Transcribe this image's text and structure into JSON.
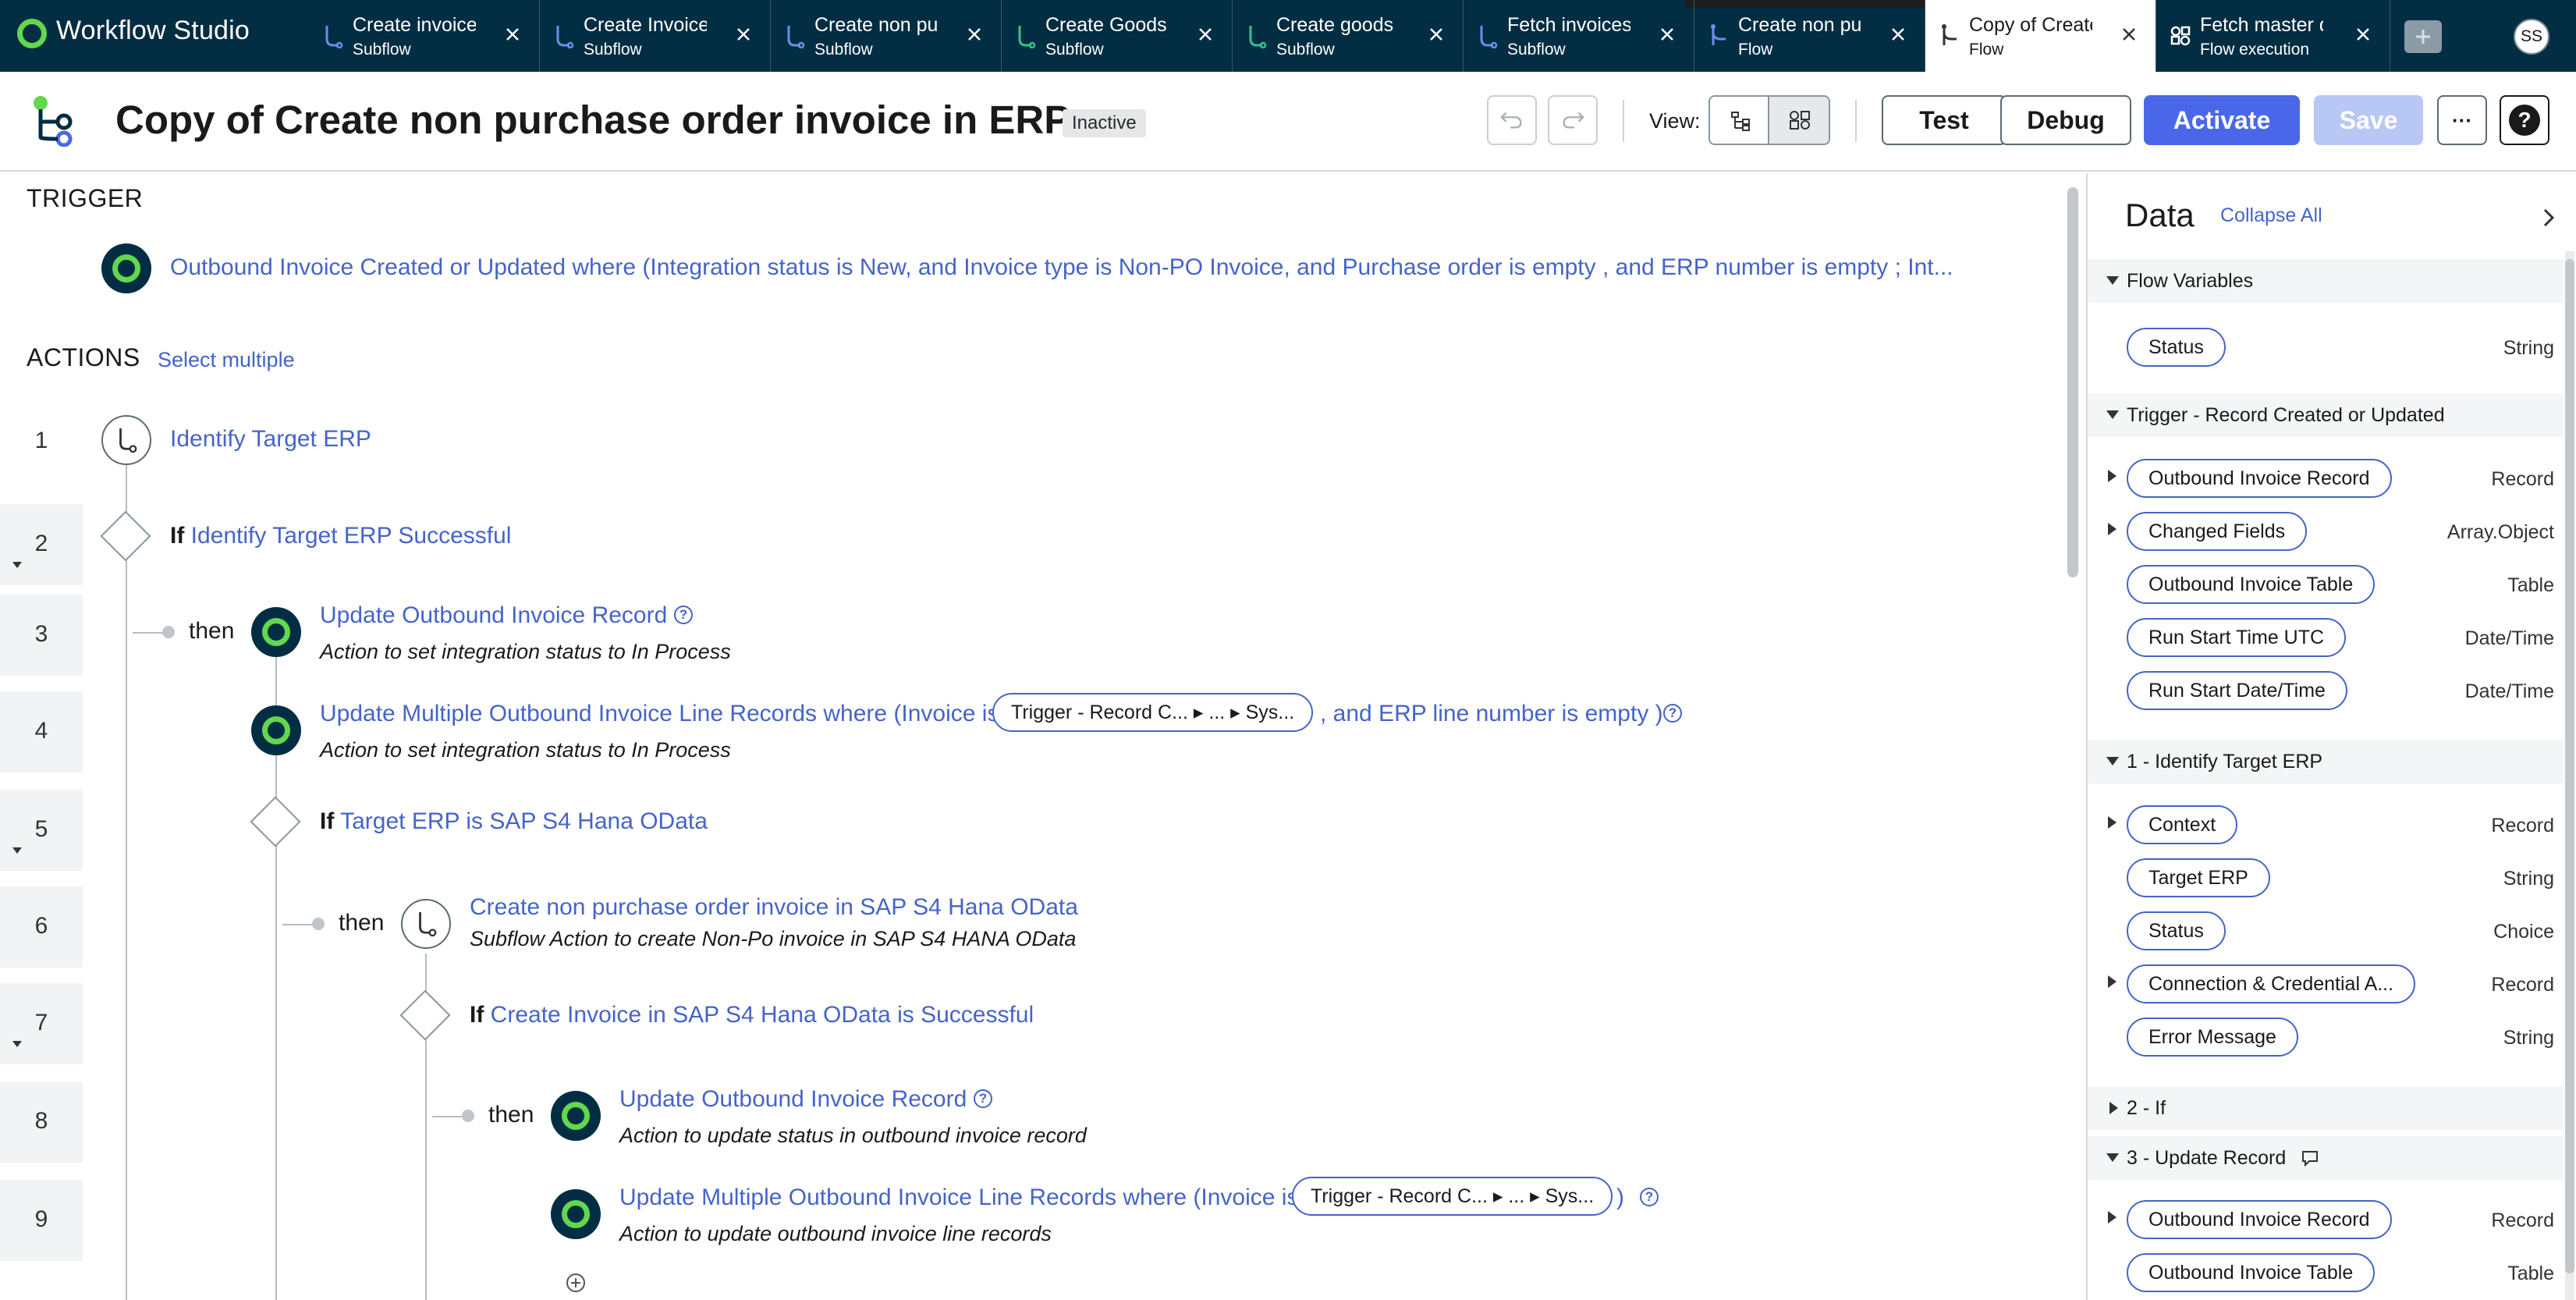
{
  "app": {
    "title": "Workflow Studio",
    "user_initials": "SS"
  },
  "tabs": [
    {
      "name": "Create invoice",
      "type": "Subflow"
    },
    {
      "name": "Create Invoice",
      "type": "Subflow"
    },
    {
      "name": "Create non pu",
      "type": "Subflow"
    },
    {
      "name": "Create Goods",
      "type": "Subflow"
    },
    {
      "name": "Create goods r",
      "type": "Subflow"
    },
    {
      "name": "Fetch invoices",
      "type": "Subflow"
    },
    {
      "name": "Create non pu",
      "type": "Flow"
    },
    {
      "name": "Copy of Create",
      "type": "Flow"
    },
    {
      "name": "Fetch master d",
      "type": "Flow execution"
    }
  ],
  "header": {
    "title": "Copy of Create non purchase order invoice in ERP",
    "status": "Inactive",
    "view_label": "View:",
    "test_label": "Test",
    "debug_label": "Debug",
    "activate_label": "Activate",
    "save_label": "Save",
    "help_label": "?",
    "more_label": "···"
  },
  "trigger": {
    "section_label": "TRIGGER",
    "text": "Outbound Invoice Created or Updated where (Integration status is New, and Invoice type is Non-PO Invoice, and Purchase order is empty , and ERP number is empty ; Int..."
  },
  "actions": {
    "section_label": "ACTIONS",
    "select_multiple": "Select multiple",
    "then_label": "then",
    "if_label": "If",
    "rows": [
      {
        "num": "1",
        "title": "Identify Target ERP"
      },
      {
        "num": "2",
        "title": "Identify Target ERP Successful"
      },
      {
        "num": "3",
        "title": "Update Outbound Invoice Record",
        "desc": "Action to set integration status to In Process"
      },
      {
        "num": "4",
        "title_pre": "Update Multiple Outbound Invoice Line Records where (Invoice is",
        "pill": "Trigger - Record C... ▸ ... ▸ Sys...",
        "title_post": ", and ERP line number is empty )",
        "desc": "Action to set integration status to In Process"
      },
      {
        "num": "5",
        "title": "Target ERP is SAP S4 Hana OData"
      },
      {
        "num": "6",
        "title": "Create non purchase order invoice in SAP S4 Hana OData",
        "desc": "Subflow Action to create Non-Po invoice in SAP S4 HANA OData"
      },
      {
        "num": "7",
        "title": "Create Invoice in SAP S4 Hana OData is Successful"
      },
      {
        "num": "8",
        "title": "Update Outbound Invoice Record",
        "desc": "Action to update status in outbound invoice record"
      },
      {
        "num": "9",
        "title_pre": "Update Multiple Outbound Invoice Line Records where (Invoice is",
        "pill": "Trigger - Record C... ▸ ... ▸ Sys...",
        "title_post": ")",
        "desc": "Action to update outbound invoice line records"
      }
    ]
  },
  "panel": {
    "title": "Data",
    "collapse_all": "Collapse All",
    "groups": [
      {
        "label": "Flow Variables",
        "vars": [
          {
            "name": "Status",
            "type": "String"
          }
        ]
      },
      {
        "label": "Trigger - Record Created or Updated",
        "vars": [
          {
            "name": "Outbound Invoice Record",
            "type": "Record"
          },
          {
            "name": "Changed Fields",
            "type": "Array.Object"
          },
          {
            "name": "Outbound Invoice Table",
            "type": "Table"
          },
          {
            "name": "Run Start Time UTC",
            "type": "Date/Time"
          },
          {
            "name": "Run Start Date/Time",
            "type": "Date/Time"
          }
        ]
      },
      {
        "label": "1 - Identify Target ERP",
        "vars": [
          {
            "name": "Context",
            "type": "Record"
          },
          {
            "name": "Target ERP",
            "type": "String"
          },
          {
            "name": "Status",
            "type": "Choice"
          },
          {
            "name": "Connection & Credential A...",
            "type": "Record"
          },
          {
            "name": "Error Message",
            "type": "String"
          }
        ]
      },
      {
        "label": "2 - If",
        "vars": []
      },
      {
        "label": "3 - Update Record",
        "vars": [
          {
            "name": "Outbound Invoice Record",
            "type": "Record"
          },
          {
            "name": "Outbound Invoice Table",
            "type": "Table"
          }
        ]
      }
    ]
  },
  "colors": {
    "topbar": "#032d42",
    "accent": "#4564c8",
    "activate": "#4967e8",
    "brand_green": "#62d84e"
  }
}
